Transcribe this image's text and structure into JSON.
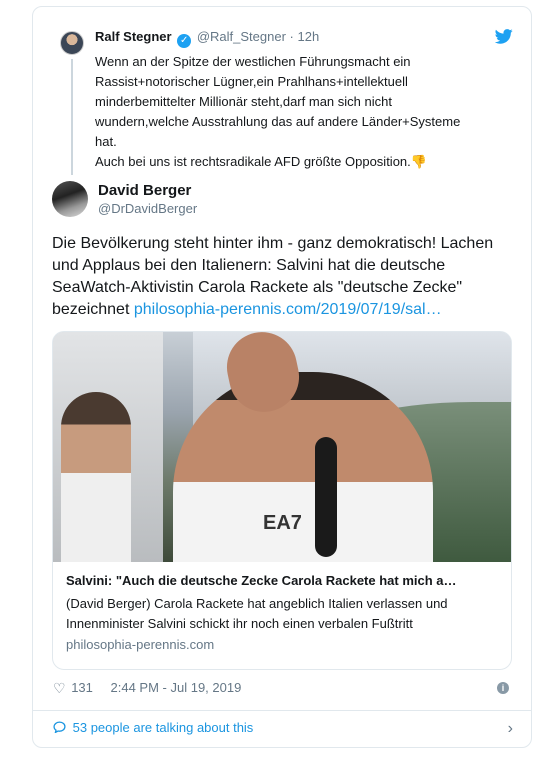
{
  "parent_tweet": {
    "name": "Ralf Stegner",
    "handle": "@Ralf_Stegner",
    "time": "12h",
    "lines": [
      "Wenn an der Spitze der westlichen Führungsmacht ein",
      "Rassist+notorischer Lügner,ein Prahlhans+intellektuell",
      "minderbemittelter Millionär steht,darf man sich nicht",
      "wundern,welche Ausstrahlung das auf andere Länder+Systeme",
      "hat.",
      "Auch bei uns ist rechtsradikale AFD größte Opposition."
    ],
    "emoji": "👎"
  },
  "tweet": {
    "name": "David Berger",
    "handle": "@DrDavidBerger",
    "lines": [
      "Die Bevölkerung steht hinter ihm - ganz demokratisch! Lachen",
      "und Applaus bei den Italienern: Salvini hat die deutsche",
      "SeaWatch-Aktivistin Carola Rackete als \"deutsche Zecke\""
    ],
    "last_line_text": "bezeichnet ",
    "link": "philosophia-perennis.com/2019/07/19/sal…"
  },
  "link_card": {
    "image_text": "EA7",
    "title": "Salvini: \"Auch die deutsche Zecke Carola Rackete hat mich a…",
    "description": [
      "(David Berger) Carola Rackete hat angeblich Italien verlassen und",
      "Innenminister Salvini schickt ihr noch einen verbalen Fußtritt"
    ],
    "domain": "philosophia-perennis.com"
  },
  "meta": {
    "likes": "131",
    "timestamp": "2:44 PM - Jul 19, 2019"
  },
  "conversation": {
    "label": "53 people are talking about this"
  },
  "colors": {
    "accent": "#1da1f2",
    "link": "#1b95e0",
    "secondary_text": "#657786",
    "border": "#e1e8ed"
  }
}
